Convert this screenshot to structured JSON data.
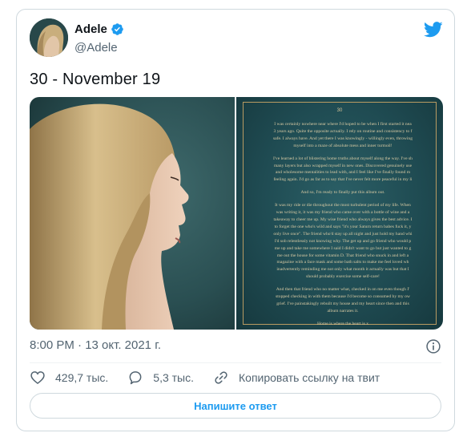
{
  "colors": {
    "accent": "#1d9bf0",
    "secondary_text": "#536471",
    "border": "#cfd9de",
    "letter_background": "#1f4b52",
    "letter_gold": "#b89b62"
  },
  "author": {
    "name": "Adele",
    "handle": "@Adele",
    "verified": true,
    "avatar_icon": "avatar-photo"
  },
  "tweet": {
    "text": "30 - November 19",
    "timestamp": "8:00 PM · 13 окт. 2021 г."
  },
  "media": {
    "photo_icon": "profile-photo",
    "letter": {
      "title": "30",
      "paragraphs": [
        [
          "I was certainly nowhere near where I'd hoped to be when I first started it nea",
          "3 years ago. Quite the opposite actually. I rely on routine and consistency to f",
          "safe. I always have. And yet there I was knowingly - willingly even, throwing",
          "myself into a maze of absolute mess and inner turmoil!"
        ],
        [
          "I've learned a lot of blistering home truths about myself along the way. I've sh",
          "many layers but also wrapped myself in new ones. Discovered genuinely use",
          "and wholesome mentalities to lead with, and I feel like I've finally found m",
          "feeling again. I'd go as far as to say that I've never felt more peaceful in my li"
        ],
        [
          "And so, I'm ready to finally put this album out."
        ],
        [
          "It was my ride or die throughout the most turbulent period of my life. When",
          "was writing it, it was my friend who came over with a bottle of wine and a",
          "takeaway to cheer me up. My wise friend who always gives the best advice. I",
          "to forget the one who's wild and says \"it's your Saturn return babes fuck it, y",
          "only live once\". The friend who'd stay up all night and just hold my hand whi",
          "I'd sob relentlessly not knowing why. The get up and go friend who would p",
          "me up and take me somewhere I said I didn't want to go but just wanted to g",
          "me out the house for some vitamin D. That friend who snuck in and left a",
          "magazine with a face mask and some bath salts to make me feel loved wh",
          "inadvertently reminding me not only what month it actually was but that I",
          "should probably exercise some self-care!"
        ],
        [
          "And then that friend who no matter what, checked in on me even though I'",
          "stopped checking in with them because I'd become so consumed by my ow",
          "grief. I've painstakingly rebuilt my house and my heart since then and this",
          "album narrates it."
        ],
        [
          "Home is where the heart is x"
        ]
      ]
    }
  },
  "stats": {
    "likes": "429,7 тыс.",
    "replies": "5,3 тыс.",
    "copy_link_label": "Копировать ссылку на твит",
    "like_icon": "heart-icon",
    "reply_icon": "comment-icon",
    "link_icon": "link-icon"
  },
  "reply_button": {
    "label": "Напишите ответ"
  },
  "icons": {
    "verified": "verified-badge-icon",
    "logo": "twitter-bird-icon",
    "info": "info-icon"
  }
}
